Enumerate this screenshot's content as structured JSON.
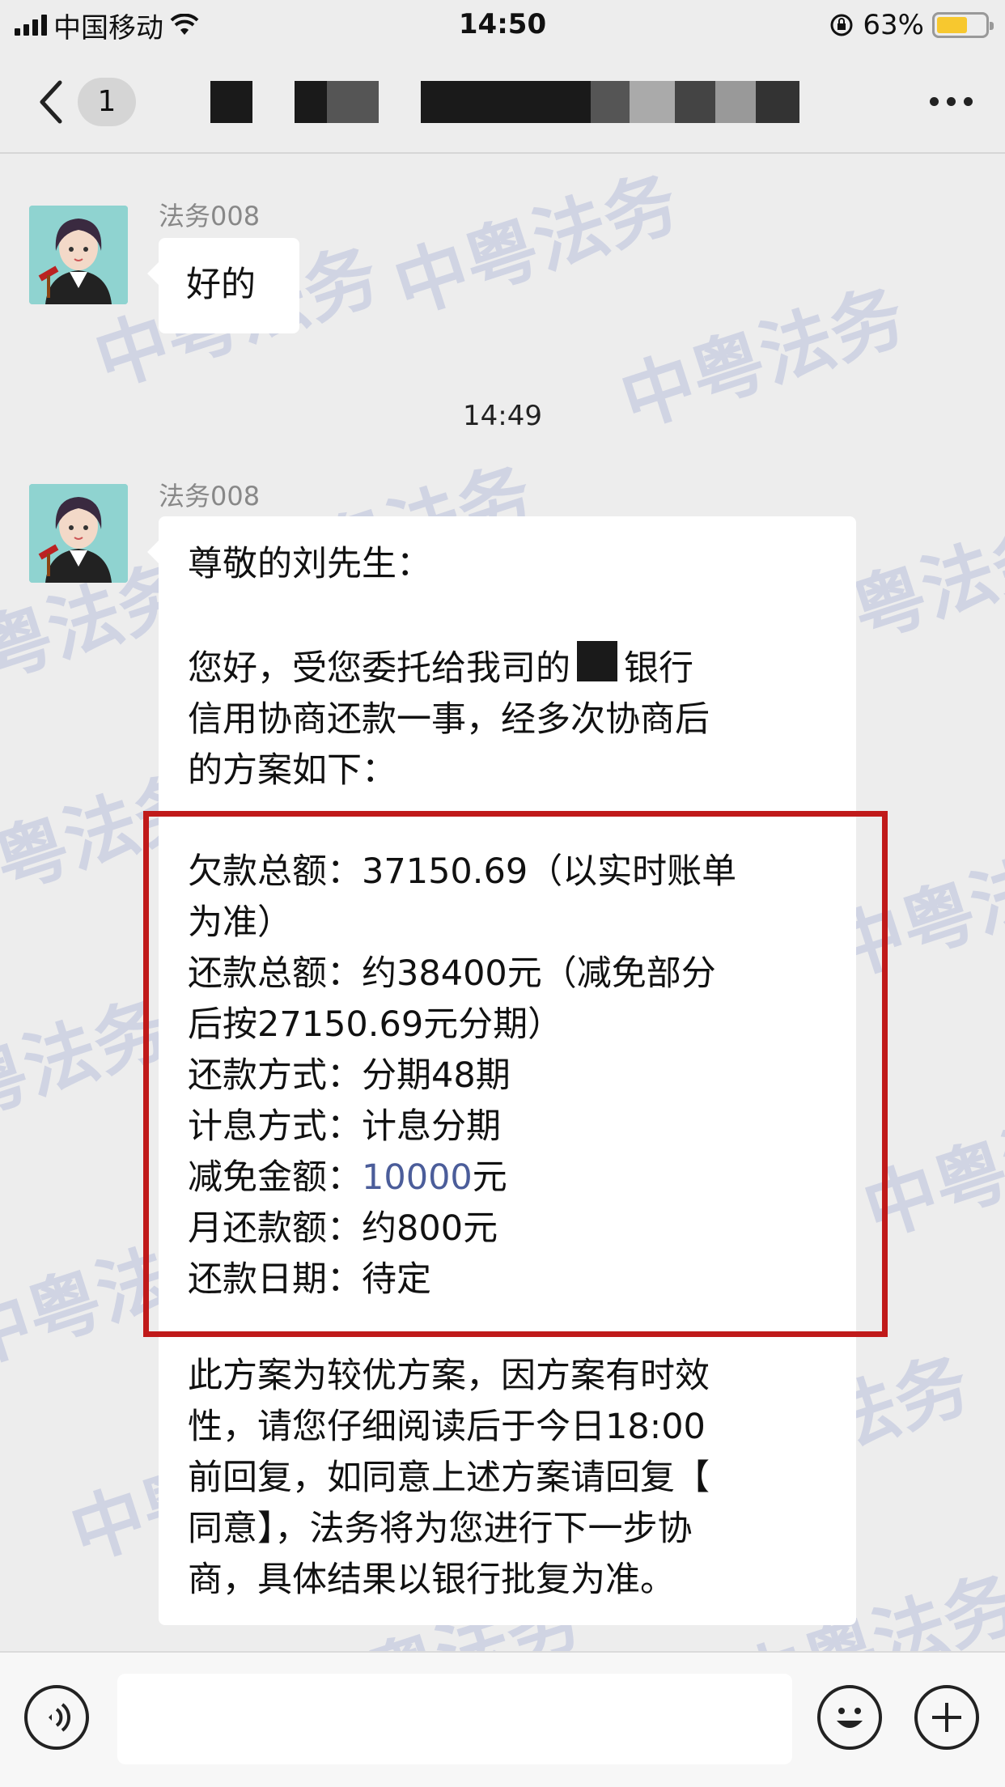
{
  "status_bar": {
    "carrier": "中国移动",
    "time": "14:50",
    "battery": "63%",
    "battery_level": 0.63
  },
  "nav": {
    "unread_count": "1"
  },
  "watermark": "中粤法务",
  "messages": [
    {
      "sender": "法务008",
      "text": "好的"
    },
    {
      "timestamp": "14:49"
    },
    {
      "sender": "法务008",
      "greeting": "尊敬的刘先生：",
      "intro_lines": [
        "您好，受您委托给我司的",
        "银行",
        "信用协商还款一事，经多次协商后",
        "的方案如下："
      ],
      "plan": {
        "debt_line1": "欠款总额：37150.69（以实时账单",
        "debt_line2": "为准）",
        "repay_line1": "还款总额：约38400元（减免部分",
        "repay_line2": "后按27150.69元分期）",
        "method": "还款方式：分期48期",
        "interest": "计息方式：计息分期",
        "waiver_prefix": "减免金额：",
        "waiver_amount": "10000",
        "waiver_suffix": "元",
        "monthly": "月还款额：约800元",
        "date": "还款日期：待定"
      },
      "closing_lines": [
        "此方案为较优方案，因方案有时效",
        "性，请您仔细阅读后于今日18:00",
        "前回复，如同意上述方案请回复【",
        "同意】，法务将为您进行下一步协",
        "商，具体结果以银行批复为准。"
      ]
    }
  ],
  "colors": {
    "highlight_border": "#c01a1a",
    "link": "#4b5d9a",
    "battery": "#f7c82f"
  }
}
